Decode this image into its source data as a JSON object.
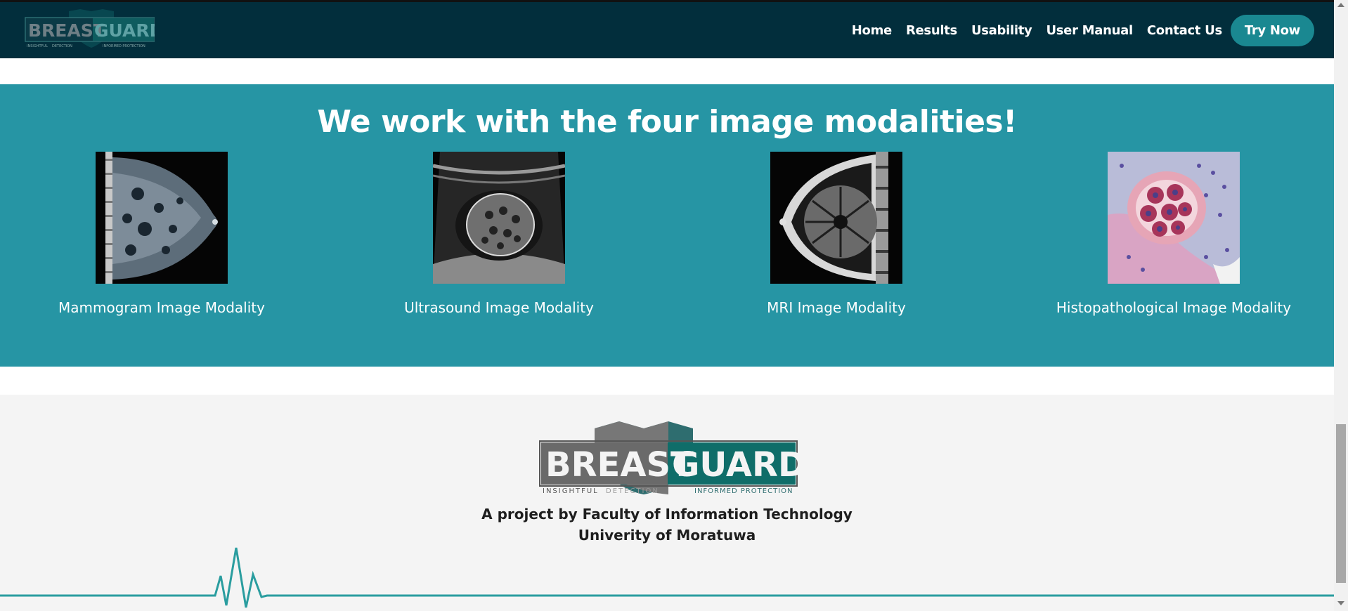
{
  "brand": {
    "name_part1": "BREAST",
    "name_part2": "GUARD",
    "tagline_left": "INSIGHTFUL",
    "tagline_mid": "DETECTION",
    "tagline_right": "INFORMED PROTECTION",
    "logo_icon": "shield-logo"
  },
  "nav": {
    "links": [
      "Home",
      "Results",
      "Usability",
      "User Manual",
      "Contact Us"
    ],
    "cta": "Try Now"
  },
  "modalities": {
    "title": "We work with the four image modalities!",
    "items": [
      {
        "label": "Mammogram Image Modality",
        "icon": "mammogram-image"
      },
      {
        "label": "Ultrasound Image Modality",
        "icon": "ultrasound-image"
      },
      {
        "label": "MRI Image Modality",
        "icon": "mri-image"
      },
      {
        "label": "Histopathological Image Modality",
        "icon": "histopathology-image"
      }
    ]
  },
  "footer": {
    "line1": "A project by Faculty of Information Technology",
    "line2": "Univerity of Moratuwa"
  },
  "colors": {
    "navbar": "#022e3c",
    "accent": "#1a8891",
    "section": "#2695a4",
    "footer": "#f4f4f4",
    "heartbeat": "#2a9d9f"
  }
}
